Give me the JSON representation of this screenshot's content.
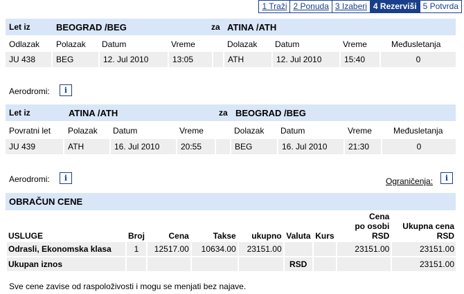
{
  "steps": [
    "1 Traži",
    "2 Ponuda",
    "3 Izaberi",
    "4 Rezerviši",
    "5 Potvrda"
  ],
  "flight1": {
    "let_iz": "Let iz",
    "from": "BEOGRAD /BEG",
    "za": "za",
    "to": "ATINA /ATH",
    "headers": [
      "Odlazak",
      "Polazak",
      "Datum",
      "Vreme",
      "Dolazak",
      "Datum",
      "Vreme",
      "Međusletanja"
    ],
    "values": [
      "JU 438",
      "BEG",
      "12. Jul 2010",
      "13:05",
      "ATH",
      "12. Jul 2010",
      "15:40",
      "0"
    ]
  },
  "flight2": {
    "let_iz": "Let iz",
    "from": "ATINA /ATH",
    "za": "za",
    "to": "BEOGRAD /BEG",
    "headers": [
      "Povratni let",
      "Polazak",
      "Datum",
      "Vreme",
      "Dolazak",
      "Datum",
      "Vreme",
      "Međusletanja"
    ],
    "values": [
      "JU 439",
      "ATH",
      "16. Jul 2010",
      "20:55",
      "BEG",
      "16. Jul 2010",
      "21:30",
      "0"
    ]
  },
  "aerodromi_label": "Aerodromi:",
  "info_glyph": "i",
  "ogranicenja_label": "Ograničenja:",
  "obracun_title": "OBRAČUN CENE",
  "price": {
    "headers": [
      "USLUGE",
      "Broj",
      "Cena",
      "Takse",
      "ukupno",
      "Valuta",
      "Kurs",
      "Cena po osobi RSD",
      "Ukupna cena RSD"
    ],
    "cena_po_osobi": [
      "Cena",
      "po osobi",
      "RSD"
    ],
    "ukupna_cena": [
      "Ukupna cena",
      "RSD"
    ],
    "row1": [
      "Odrasli, Ekonomska klasa",
      "1",
      "12517.00",
      "10634.00",
      "23151.00",
      "",
      "",
      "23151.00",
      "23151.00"
    ],
    "total_label": "Ukupan iznos",
    "total_currency": "RSD",
    "total_value": "23151.00"
  },
  "note": "Sve cene zavise od raspoloživosti i mogu se menjati bez najave."
}
